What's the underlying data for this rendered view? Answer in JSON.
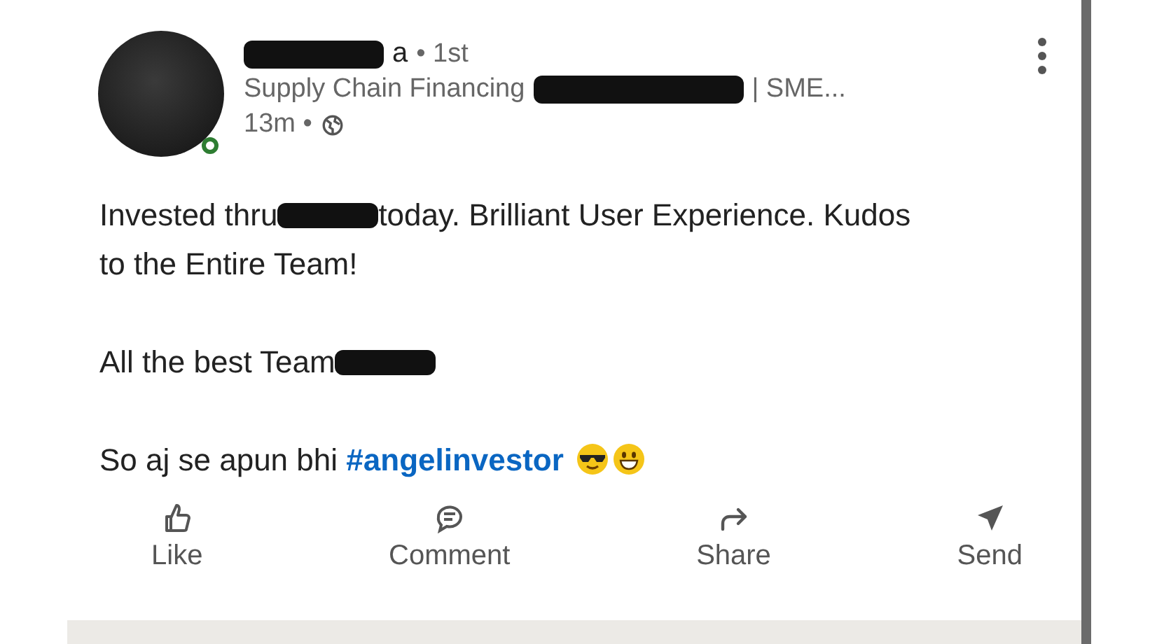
{
  "post": {
    "author": {
      "name_visible": "a",
      "degree": "• 1st",
      "online": true
    },
    "headline": [
      "Supply Chain Financing",
      "| SME..."
    ],
    "time": "13m •",
    "body": [
      {
        "kind": "text",
        "lines": [
          {
            "text": "Invested thru",
            "redacted": true,
            "after": "today. Brilliant User Experience. Kudos"
          },
          {
            "text": "to the Entire Team!",
            "redacted": false
          }
        ]
      },
      {
        "kind": "text",
        "lines": [
          {
            "text": "All the best Team",
            "redacted": true
          }
        ]
      },
      {
        "kind": "hashtag",
        "text": "So aj se apun bhi",
        "tag": "#angelinvestor"
      }
    ],
    "actions": [
      {
        "label": "Like",
        "kind": "like"
      },
      {
        "label": "Comment",
        "kind": "comment"
      },
      {
        "label": "Share",
        "kind": "share"
      },
      {
        "label": "Send",
        "kind": "send"
      }
    ]
  }
}
